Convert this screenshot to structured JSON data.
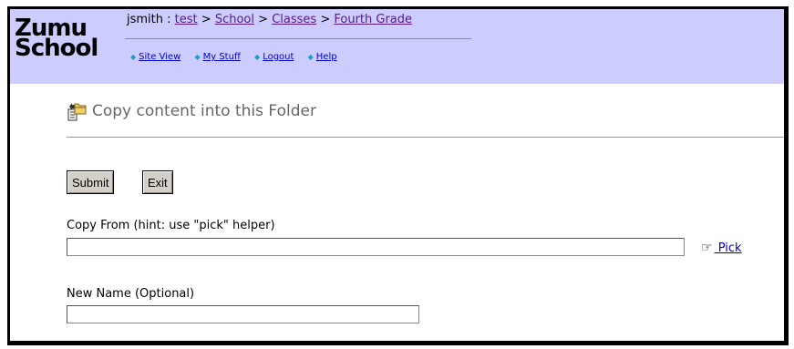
{
  "logo": {
    "line1": "Zumu",
    "line2": "School"
  },
  "breadcrumb": {
    "user": "jsmith",
    "separator": ":",
    "items": [
      "test",
      "School",
      "Classes",
      "Fourth Grade"
    ],
    "arrow": ">"
  },
  "nav": {
    "links": [
      "Site View",
      "My Stuff",
      "Logout",
      "Help"
    ]
  },
  "page": {
    "title": "Copy content into this Folder"
  },
  "buttons": {
    "submit": "Submit",
    "exit": "Exit"
  },
  "copy_from": {
    "label": "Copy From (hint: use \"pick\" helper)",
    "value": "",
    "pick_label": " Pick"
  },
  "new_name": {
    "label": "New Name (Optional)",
    "value": ""
  },
  "icons": {
    "folder": "folder-copy-icon",
    "hand": "pointing-hand-icon",
    "bullet": "diamond-bullet-icon"
  },
  "colors": {
    "header_bg": "#ccccff",
    "link": "#0000cc",
    "visited_link": "#551a8b"
  }
}
